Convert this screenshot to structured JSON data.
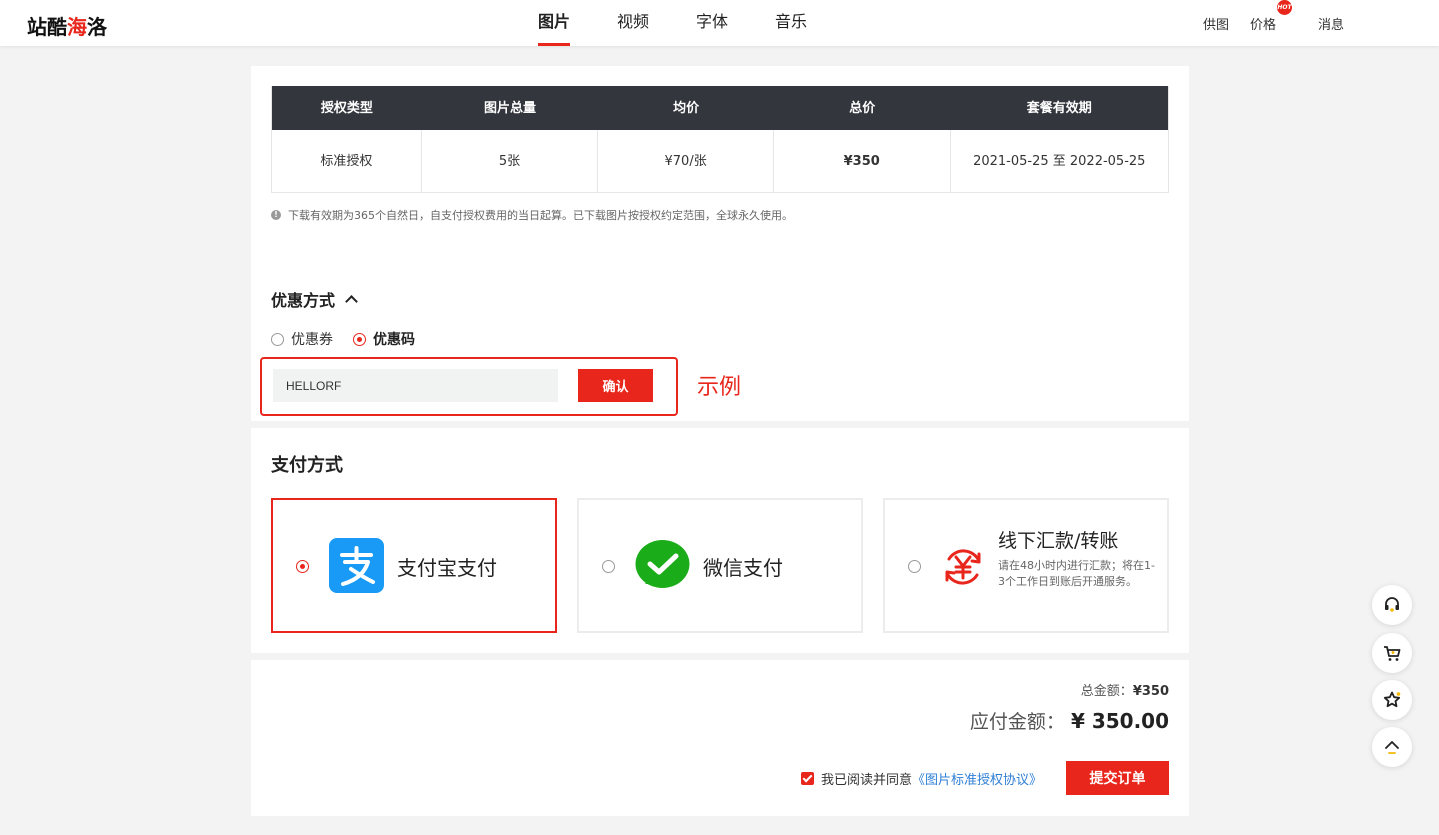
{
  "header": {
    "logo_text_a": "站酷",
    "logo_text_b": "海",
    "logo_text_c": "洛",
    "nav": [
      "图片",
      "视频",
      "字体",
      "音乐"
    ],
    "right_nav": {
      "supply": "供图",
      "price": "价格",
      "hot": "HOT",
      "messages": "消息"
    }
  },
  "license_table": {
    "headers": [
      "授权类型",
      "图片总量",
      "均价",
      "总价",
      "套餐有效期"
    ],
    "row": [
      "标准授权",
      "5张",
      "¥70/张",
      "¥350",
      "2021-05-25 至 2022-05-25"
    ]
  },
  "note": "下载有效期为365个自然日，自支付授权费用的当日起算。已下载图片按授权约定范围，全球永久使用。",
  "discount": {
    "title": "优惠方式",
    "options": [
      "优惠券",
      "优惠码"
    ],
    "selected": "优惠码",
    "code_value": "HELLORF",
    "confirm_label": "确认",
    "example_label": "示例"
  },
  "payment": {
    "title": "支付方式",
    "alipay": "支付宝支付",
    "wechat": "微信支付",
    "offline_title": "线下汇款/转账",
    "offline_desc": "请在48小时内进行汇款；将在1-3个工作日到账后开通服务。",
    "selected": "支付宝支付"
  },
  "summary": {
    "total_label": "总金额：",
    "total_value": "¥350",
    "payable_label": "应付金额：",
    "payable_value": "¥ 350.00",
    "agree_text": "我已阅读并同意",
    "agree_link": "《图片标准授权协议》",
    "submit_label": "提交订单"
  },
  "colors": {
    "accent": "#e8261b",
    "table_header": "#33363d",
    "link": "#2f7fd6",
    "alipay": "#1a9af7",
    "wechat": "#1aad19"
  }
}
